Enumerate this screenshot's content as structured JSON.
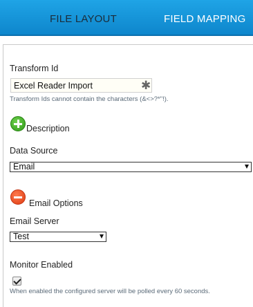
{
  "tabs": [
    {
      "label": "FILE LAYOUT",
      "active": false
    },
    {
      "label": "FIELD MAPPING",
      "active": true
    }
  ],
  "form": {
    "transform_id": {
      "label": "Transform Id",
      "value": "Excel Reader Import",
      "hint": "Transform Ids cannot contain the characters (&<>?*\"!).",
      "required_icon": "asterisk-icon"
    },
    "description": {
      "label": "Description",
      "toggle_icon": "plus-circle-icon",
      "toggle_color": "#3cab22"
    },
    "data_source": {
      "label": "Data Source",
      "selected": "Email"
    },
    "email_options": {
      "label": "Email Options",
      "toggle_icon": "minus-circle-icon",
      "toggle_color": "#ea4a1c"
    },
    "email_server": {
      "label": "Email Server",
      "selected": "Test"
    },
    "monitor_enabled": {
      "label": "Monitor Enabled",
      "checked": true,
      "hint": "When enabled the configured server will be polled every 60 seconds."
    }
  },
  "colors": {
    "tab_bar": "#1596d9",
    "active_tab_text": "#ffffff",
    "inactive_tab_text": "#1b2c3a",
    "hint_text": "#5a6a78"
  }
}
